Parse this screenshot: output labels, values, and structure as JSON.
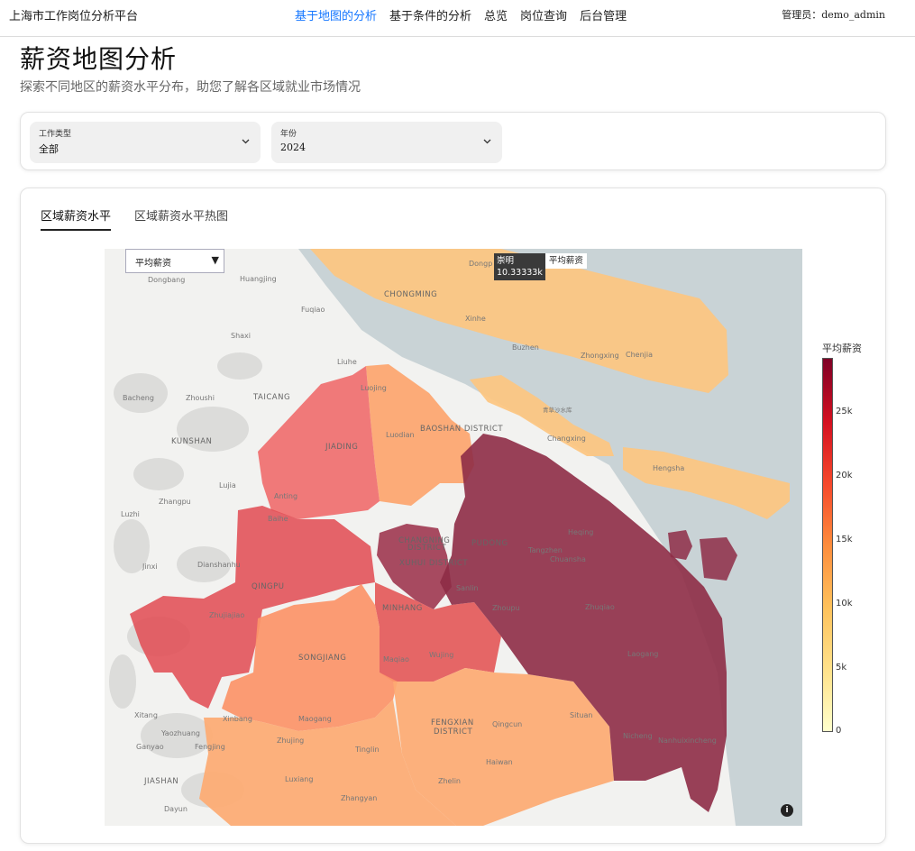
{
  "header": {
    "brand": "上海市工作岗位分析平台",
    "nav": [
      "基于地图的分析",
      "基于条件的分析",
      "总览",
      "岗位查询",
      "后台管理"
    ],
    "user": "管理员：demo_admin"
  },
  "page": {
    "title": "薪资地图分析",
    "subtitle": "探索不同地区的薪资水平分布，助您了解各区域就业市场情况"
  },
  "filters": {
    "job_type": {
      "label": "工作类型",
      "value": "全部"
    },
    "year": {
      "label": "年份",
      "value": "2024"
    }
  },
  "tabs": [
    "区域薪资水平",
    "区域薪资水平热图"
  ],
  "map": {
    "metric_select": "平均薪资",
    "tooltip": {
      "district": "崇明",
      "value": "10.33333k",
      "metric": "平均薪资"
    },
    "info_icon": "i",
    "place_labels": {
      "dongbang": "Dongbang",
      "huangjing": "Huangjing",
      "fuqiao": "Fuqiao",
      "shaxi": "Shaxi",
      "liuhe": "Liuhe",
      "bacheng": "Bacheng",
      "zhoushi": "Zhoushi",
      "taicang": "TAICANG",
      "kunshan": "KUNSHAN",
      "luojing": "Luojing",
      "luodian": "Luodian",
      "baoshan": "BAOSHAN DISTRICT",
      "jiading": "JIADING",
      "lujia": "Lujia",
      "anting": "Anting",
      "zhangpu": "Zhangpu",
      "luzhi": "Luzhi",
      "baihe": "Baihe",
      "changning": "CHANGNING",
      "district": "DISTRICT",
      "xuhui": "XUHUI DISTRICT",
      "pudong": "PUDONG",
      "jinxi": "Jinxi",
      "dianshanhu": "Dianshanhu",
      "qingpu": "QINGPU",
      "zhujiajiao": "Zhujiajiao",
      "minhang": "MINHANG",
      "sanlin": "Sanlin",
      "zhoupu": "Zhoupu",
      "zhuqiao": "Zhuqiao",
      "songjiang": "SONGJIANG",
      "maqiao": "Maqiao",
      "wujing": "Wujing",
      "laogang": "Laogang",
      "xitang": "Xitang",
      "xinbang": "Xinbang",
      "maogang": "Maogang",
      "yaozhuang": "Yaozhuang",
      "ganyao": "Ganyao",
      "fengjing": "Fengjing",
      "zhujing": "Zhujing",
      "tinglin": "Tinglin",
      "fengxian": "FENGXIAN",
      "qingcun": "Qingcun",
      "situan": "Situan",
      "nicheng": "Nicheng",
      "nanhuixincheng": "Nanhuixincheng",
      "haiwan": "Haiwan",
      "jiashan": "JIASHAN",
      "luxiang": "Luxiang",
      "zhelin": "Zhelin",
      "zhangyan": "Zhangyan",
      "dayun": "Dayun",
      "chongming": "CHONGMING",
      "xinhe": "Xinhe",
      "buzhen": "Buzhen",
      "zhongxing": "Zhongxing",
      "chenjia": "Chenjia",
      "dongping": "Dongp",
      "changxing": "Changxing",
      "hengsha": "Hengsha",
      "heqing": "Heqing",
      "tangzhen": "Tangzhen",
      "chuansha": "Chuansha",
      "qingcaosha": "青草沙水库"
    }
  },
  "legend": {
    "title": "平均薪资",
    "ticks": [
      "25k",
      "20k",
      "15k",
      "10k",
      "5k",
      "0"
    ]
  },
  "colors": {
    "active_nav": "#1677ff",
    "chongming": "#fdc680",
    "jiading": "#ef6b6b",
    "pudong": "#8e2c46",
    "fengxian": "#fdaa72"
  }
}
